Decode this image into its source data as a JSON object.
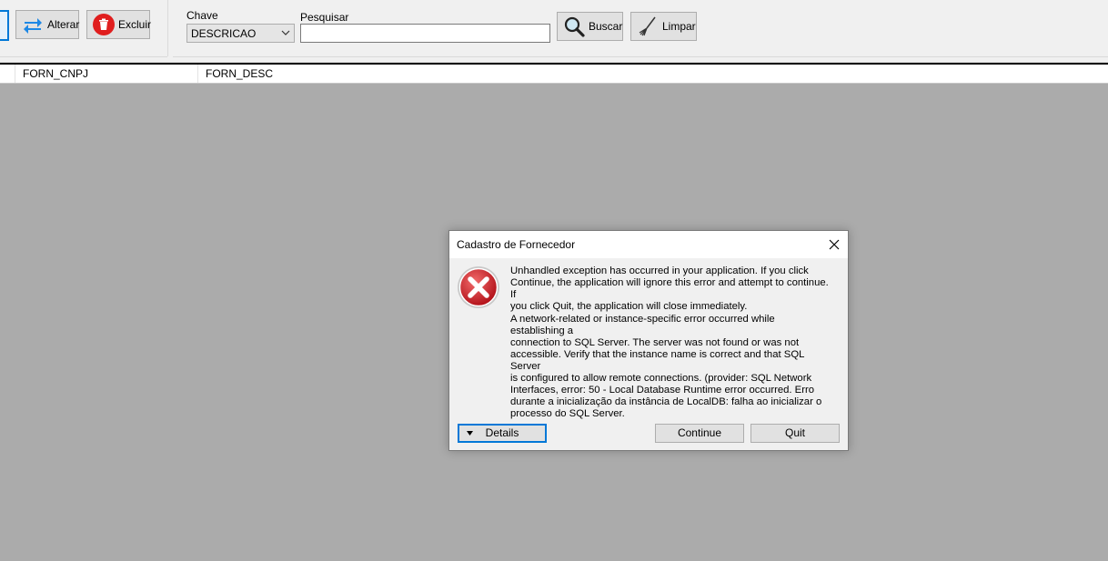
{
  "toolbar": {
    "alterar_label": "Alterar",
    "excluir_label": "Excluir",
    "chave_label": "Chave",
    "chave_value": "DESCRICAO",
    "pesquisar_label": "Pesquisar",
    "pesquisar_value": "",
    "buscar_label": "Buscar",
    "limpar_label": "Limpar"
  },
  "grid": {
    "columns": [
      "FORN_CNPJ",
      "FORN_DESC"
    ]
  },
  "dialog": {
    "title": "Cadastro de Fornecedor",
    "message1": "Unhandled exception has occurred in your application. If you click\nContinue, the application will ignore this error and attempt to continue. If\nyou click Quit, the application will close immediately.",
    "message2": "A network-related or instance-specific error occurred while establishing a\nconnection to SQL Server. The server was not found or was not\naccessible. Verify that the instance name is correct and that SQL Server\nis configured to allow remote connections. (provider: SQL Network\nInterfaces, error: 50 - Local Database Runtime error occurred. Erro\ndurante a inicialização da instância de LocalDB: falha ao inicializar o\nprocesso do SQL Server.",
    "details_label": "Details",
    "continue_label": "Continue",
    "quit_label": "Quit"
  },
  "icons": {
    "error": "error-x-icon",
    "close": "close-icon"
  },
  "colors": {
    "focus_blue": "#0078d7",
    "error_red": "#d9262c",
    "background_gray": "#ababab"
  }
}
